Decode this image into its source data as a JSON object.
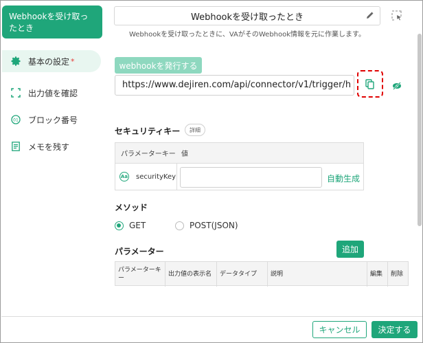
{
  "sidebar": {
    "header": "Webhookを受け取ったとき",
    "items": [
      {
        "label": "基本の設定",
        "required": "*"
      },
      {
        "label": "出力値を確認"
      },
      {
        "label": "ブロック番号"
      },
      {
        "label": "メモを残す"
      }
    ]
  },
  "header": {
    "title": "Webhookを受け取ったとき",
    "subtitle": "Webhookを受け取ったときに、VAがそのWebhook情報を元に作業します。"
  },
  "webhook": {
    "issue_label": "webhookを発行する",
    "url": "https://www.dejiren.com/api/connector/v1/trigger/h"
  },
  "security": {
    "title": "セキュリティキー",
    "detail_label": "詳細",
    "col_key": "パラメーターキー",
    "col_value": "値",
    "row_key": "securityKey",
    "row_value": "",
    "auto_generate": "自動生成",
    "aa_glyph": "Aa"
  },
  "method": {
    "title": "メソッド",
    "options": [
      {
        "label": "GET",
        "selected": true
      },
      {
        "label": "POST(JSON)",
        "selected": false
      }
    ]
  },
  "parameters": {
    "title": "パラメーター",
    "add_label": "追加",
    "columns": [
      "パラメーターキー",
      "出力値の表示名",
      "データタイプ",
      "説明",
      "編集",
      "削除"
    ]
  },
  "footer": {
    "cancel_label": "キャンセル",
    "decide_label": "決定する"
  },
  "colors": {
    "accent": "#1fa67a",
    "highlight": "#e00000"
  }
}
